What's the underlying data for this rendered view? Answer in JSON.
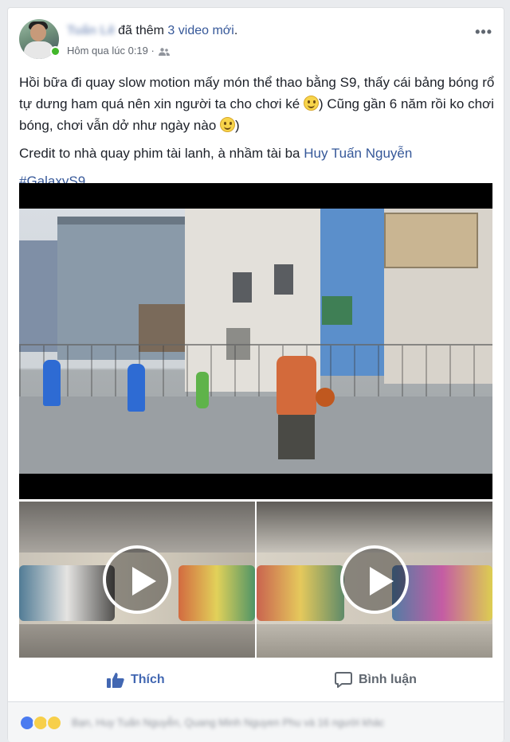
{
  "post": {
    "author": "Tuấn Lê",
    "action_prefix": "đã thêm",
    "action_link": "3 video mới",
    "action_suffix": ".",
    "timestamp": "Hôm qua lúc 0:19 ·",
    "privacy_icon": "friends-icon",
    "more_menu": "•••",
    "text": {
      "p1_a": "Hồi bữa đi quay slow motion mấy món thể thao bằng S9, thấy cái bảng bóng rổ tự dưng ham quá nên xin người ta cho chơi ké ",
      "p1_b": ") Cũng gần 6 năm rồi ko chơi bóng, chơi vẫn dở như ngày nào ",
      "p1_c": ")",
      "p2_a": "Credit to nhà quay phim tài lanh, à nhầm tài ba ",
      "p2_link": "Huy Tuấn Nguyễn",
      "hashtag": "#GalaxyS9"
    }
  },
  "actions": {
    "like_label": "Thích",
    "comment_label": "Bình luận"
  },
  "reactions": {
    "icons": [
      "like-icon",
      "haha-icon",
      "wow-icon"
    ],
    "summary": "Bạn, Huy Tuấn Nguyễn, Quang Minh Nguyen Phu và 16 người khác"
  },
  "colors": {
    "link": "#365899",
    "like_blue": "#4267b2",
    "online": "#42b72a"
  }
}
